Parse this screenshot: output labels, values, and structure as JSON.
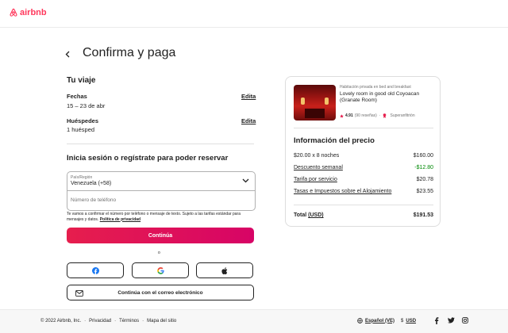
{
  "brand": {
    "name": "airbnb",
    "color": "#ff385c"
  },
  "page": {
    "title": "Confirma y paga",
    "back_icon": "chevron-left-icon"
  },
  "trip": {
    "heading": "Tu viaje",
    "dates_label": "Fechas",
    "dates_value": "15 – 23 de abr",
    "dates_edit": "Edita",
    "guests_label": "Huéspedes",
    "guests_value": "1 huésped",
    "guests_edit": "Edita"
  },
  "login": {
    "heading": "Inicia sesión o regístrate para poder reservar",
    "country_label": "País/Región",
    "country_value": "Venezuela (+58)",
    "phone_placeholder": "Número de teléfono",
    "disclaimer": "Te vamos a confirmar el número por teléfono o mensaje de texto. Sujeto a las tarifas estándar para mensajes y datos.",
    "privacy_link": "Política de privacidad",
    "continue_label": "Continúa",
    "or_label": "o",
    "social": [
      "facebook-icon",
      "google-icon",
      "apple-icon"
    ],
    "email_label": "Continúa con el correo electrónico"
  },
  "listing": {
    "type": "Habitación privada en bed and breakfast",
    "name": "Lovely room in good old Coyoacan (Granate Room)",
    "rating": "4.91",
    "reviews": "(90 reseñas)",
    "separator": "·",
    "badge": "Superanfitrión"
  },
  "price": {
    "heading": "Información del precio",
    "rows": [
      {
        "label": "$20.00 x 8 noches",
        "value": "$160.00"
      },
      {
        "label": "Descuento semanal",
        "value": "-$12.80"
      },
      {
        "label": "Tarifa por servicio",
        "value": "$20.78"
      },
      {
        "label": "Tasas e Impuestos sobre el Alojamiento",
        "value": "$23.55"
      }
    ],
    "total_label": "Total",
    "total_currency": "(USD)",
    "total_value": "$191.53",
    "discount_color": "#008a05"
  },
  "footer": {
    "copyright": "© 2022 Airbnb, Inc.",
    "dot": "·",
    "links": [
      "Privacidad",
      "Términos",
      "Mapa del sitio"
    ],
    "language": "Español (VE)",
    "currency_symbol": "$",
    "currency": "USD",
    "social": [
      "facebook-icon",
      "twitter-icon",
      "instagram-icon"
    ]
  },
  "colors": {
    "accent": "#e61e4d",
    "text": "#222222",
    "muted": "#717171"
  }
}
